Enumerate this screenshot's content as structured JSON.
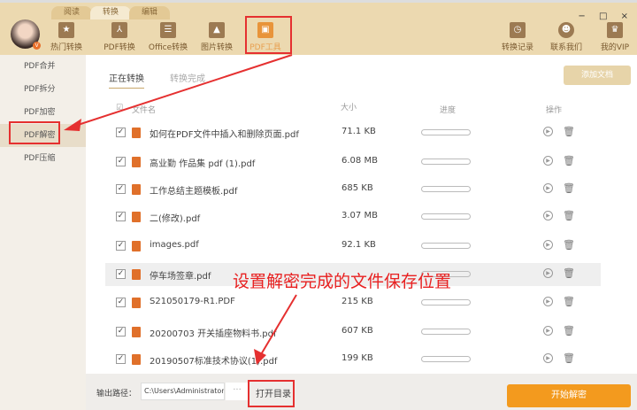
{
  "tabs": [
    "阅读",
    "转换",
    "编辑"
  ],
  "tools": [
    "热门转换",
    "PDF转换",
    "Office转换",
    "图片转换",
    "PDF工具"
  ],
  "right_tools": [
    "转换记录",
    "联系我们",
    "我的VIP"
  ],
  "window_controls": "− □ ×",
  "sidebar": [
    "PDF合并",
    "PDF拆分",
    "PDF加密",
    "PDF解密",
    "PDF压缩"
  ],
  "content_tabs": [
    "正在转换",
    "转换完成"
  ],
  "add_button": "添加文档",
  "headers": {
    "name": "文件名",
    "size": "大小",
    "progress": "进度",
    "action": "操作"
  },
  "files": [
    {
      "name": "如何在PDF文件中插入和删除页面.pdf",
      "size": "71.1 KB"
    },
    {
      "name": "高业勤 作品集 pdf (1).pdf",
      "size": "6.08 MB"
    },
    {
      "name": "工作总结主题模板.pdf",
      "size": "685 KB"
    },
    {
      "name": "二(修改).pdf",
      "size": "3.07 MB"
    },
    {
      "name": "images.pdf",
      "size": "92.1 KB"
    },
    {
      "name": "停车场签章.pdf",
      "size": ""
    },
    {
      "name": "S21050179-R1.PDF",
      "size": "215 KB"
    },
    {
      "name": "20200703 开关插座物料书.pdf",
      "size": "607 KB"
    },
    {
      "name": "20190507标准技术协议(1).pdf",
      "size": "199 KB"
    }
  ],
  "footer": {
    "label": "输出路径：",
    "path": "C:\\Users\\Administrator",
    "dots": "···",
    "open": "打开目录",
    "start": "开始解密"
  },
  "annotation": "设置解密完成的文件保存位置"
}
